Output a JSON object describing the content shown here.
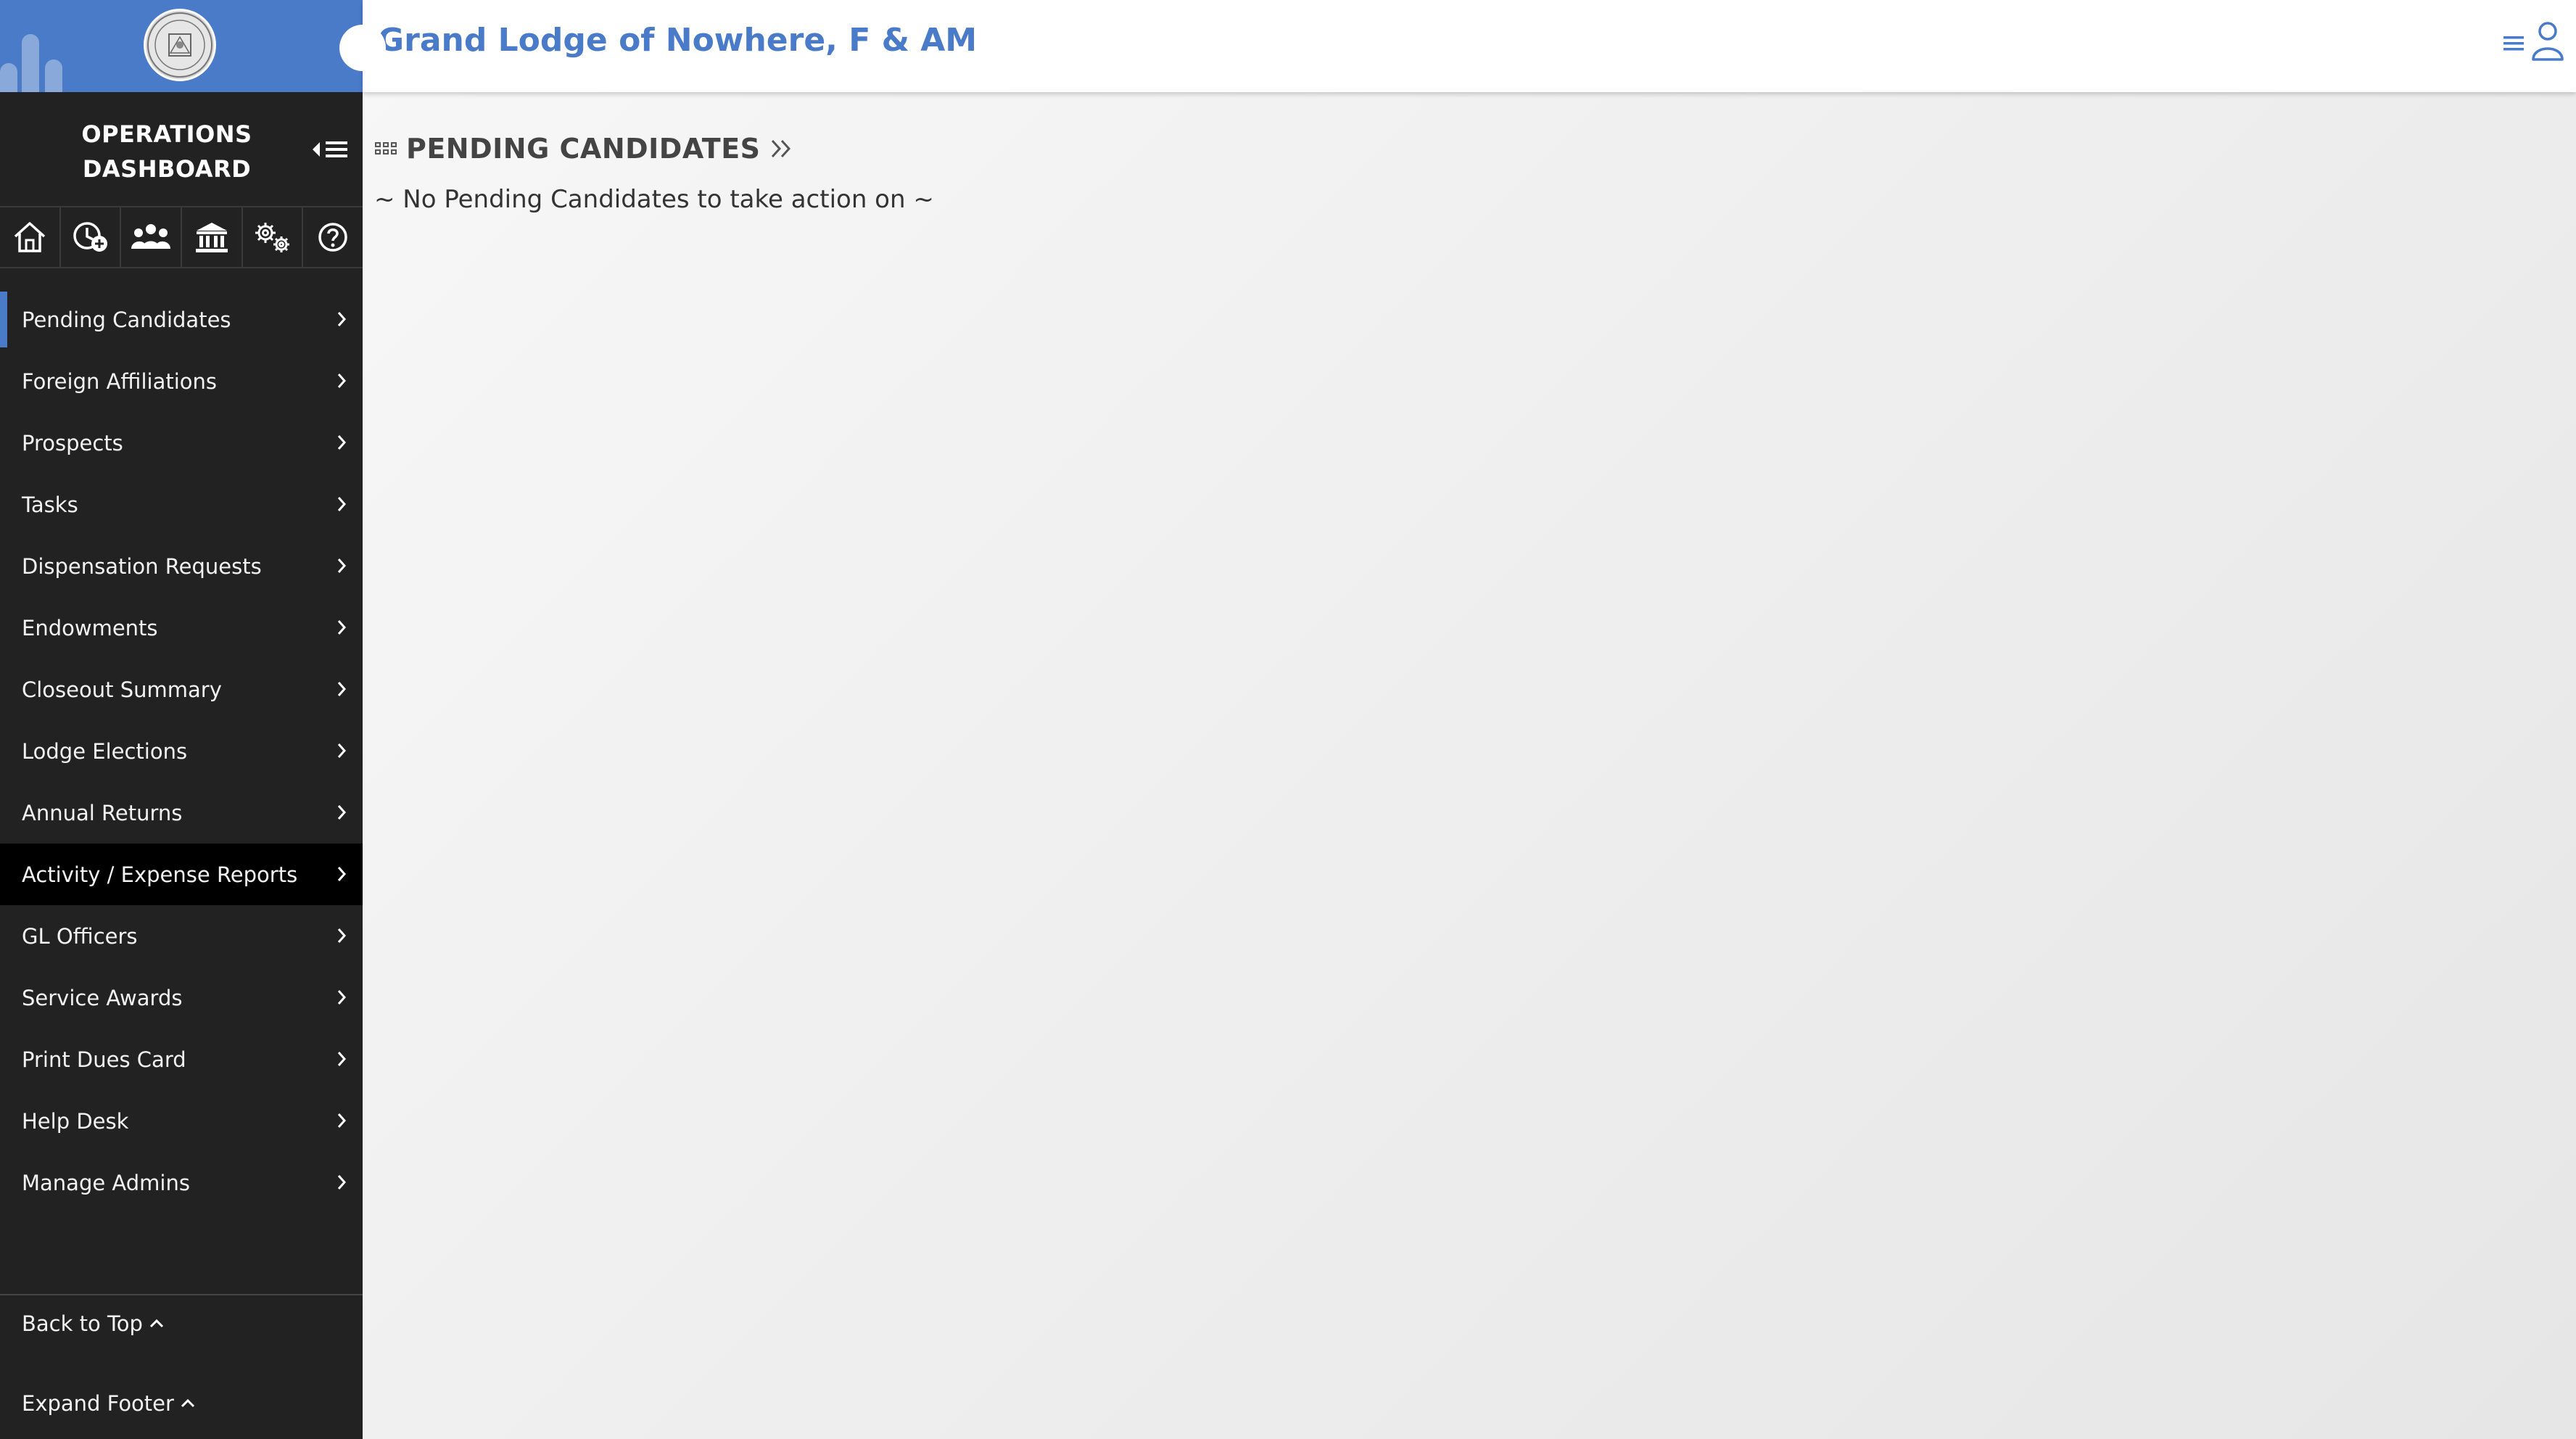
{
  "header": {
    "site_title": "Grand Lodge of Nowhere, F & AM"
  },
  "sidebar": {
    "dashboard_title_line1": "OPERATIONS",
    "dashboard_title_line2": "DASHBOARD",
    "icon_bar": [
      "home-icon",
      "add-time-icon",
      "members-icon",
      "lodge-building-icon",
      "settings-gears-icon",
      "help-icon"
    ],
    "items": [
      {
        "label": "Pending Candidates"
      },
      {
        "label": "Foreign Affiliations"
      },
      {
        "label": "Prospects"
      },
      {
        "label": "Tasks"
      },
      {
        "label": "Dispensation Requests"
      },
      {
        "label": "Endowments"
      },
      {
        "label": "Closeout Summary"
      },
      {
        "label": "Lodge Elections"
      },
      {
        "label": "Annual Returns"
      },
      {
        "label": "Activity / Expense Reports"
      },
      {
        "label": "GL Officers"
      },
      {
        "label": "Service Awards"
      },
      {
        "label": "Print Dues Card"
      },
      {
        "label": "Help Desk"
      },
      {
        "label": "Manage Admins"
      }
    ],
    "back_to_top": "Back to Top",
    "expand_footer": "Expand Footer"
  },
  "main": {
    "section_title": "PENDING CANDIDATES",
    "empty_message": "~ No Pending Candidates to take action on ~"
  },
  "colors": {
    "accent": "#4a7bc8",
    "sidebar_bg": "#222222",
    "hover_bg": "#000000"
  }
}
